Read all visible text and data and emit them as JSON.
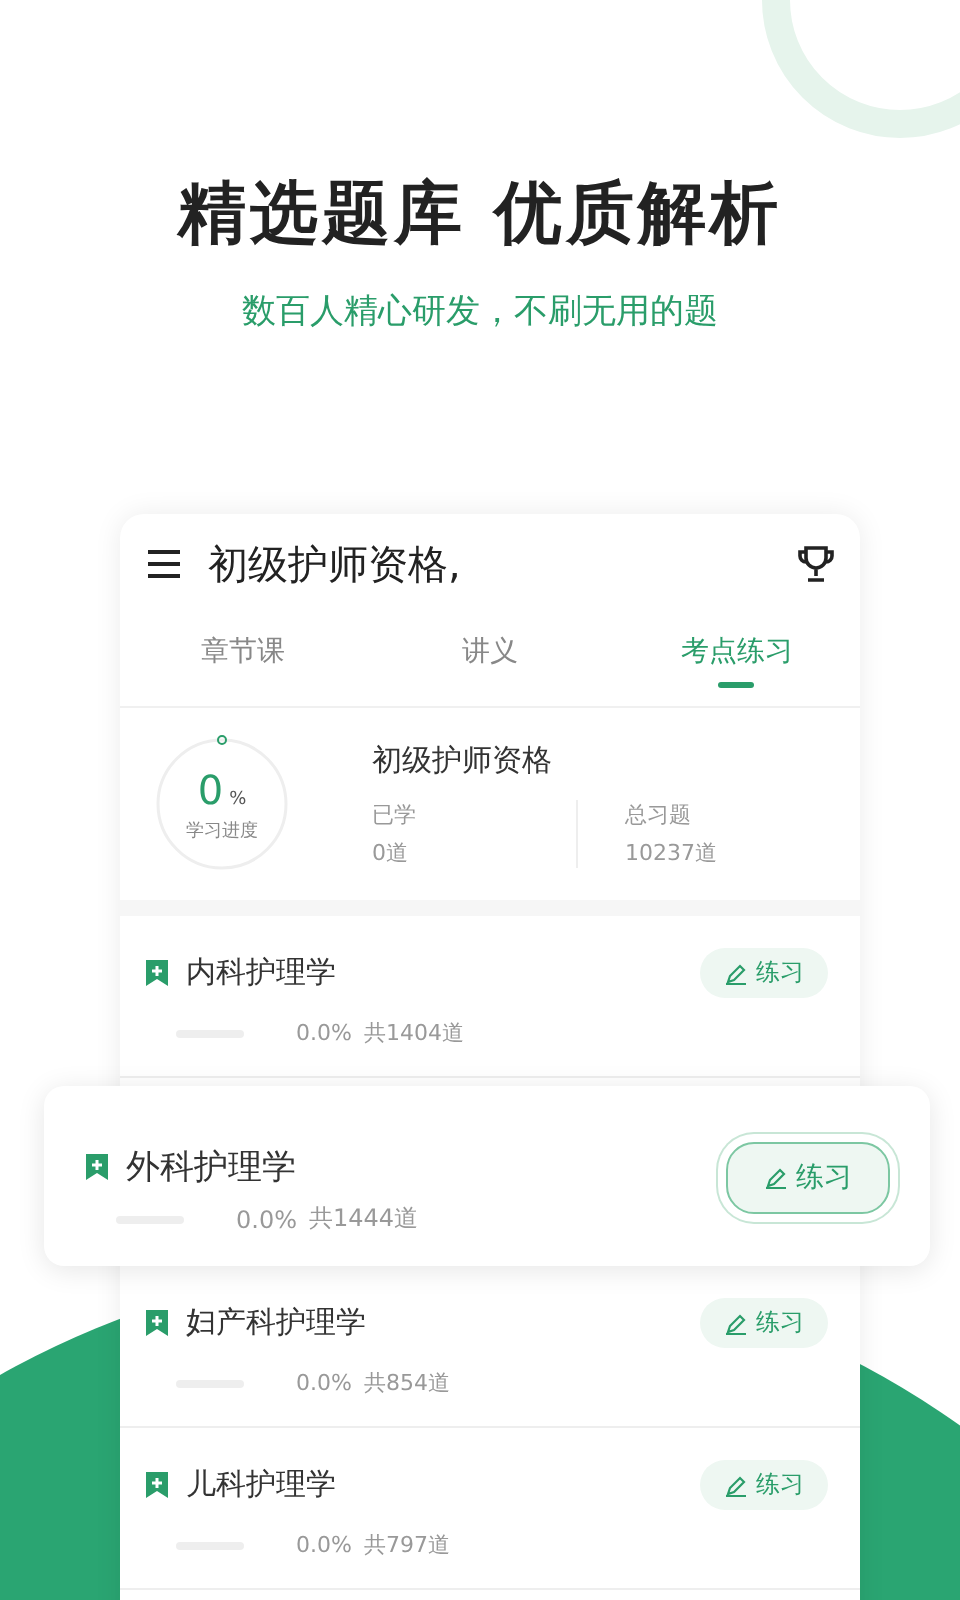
{
  "headline": "精选题库 优质解析",
  "subtitle": "数百人精心研发，不刷无用的题",
  "header": {
    "title": "初级护师资格,"
  },
  "tabs": [
    {
      "label": "章节课",
      "selected": false
    },
    {
      "label": "讲义",
      "selected": false
    },
    {
      "label": "考点练习",
      "selected": true
    }
  ],
  "summary": {
    "percent": "0",
    "percent_unit": "%",
    "progress_label": "学习进度",
    "level": 0,
    "title": "初级护师资格",
    "stats": [
      {
        "label": "已学",
        "value": "0道"
      },
      {
        "label": "总习题",
        "value": "10237道"
      }
    ]
  },
  "rows": [
    {
      "name": "内科护理学",
      "level": 0,
      "percent": "0.0%",
      "total": "共1404道",
      "button": "练习",
      "highlighted": false
    },
    {
      "name": "外科护理学",
      "level": 0,
      "percent": "0.0%",
      "total": "共1444道",
      "button": "练习",
      "highlighted": true
    },
    {
      "name": "妇产科护理学",
      "level": 0,
      "percent": "0.0%",
      "total": "共854道",
      "button": "练习",
      "highlighted": false
    },
    {
      "name": "儿科护理学",
      "level": 0,
      "percent": "0.0%",
      "total": "共797道",
      "button": "练习",
      "highlighted": false
    }
  ]
}
